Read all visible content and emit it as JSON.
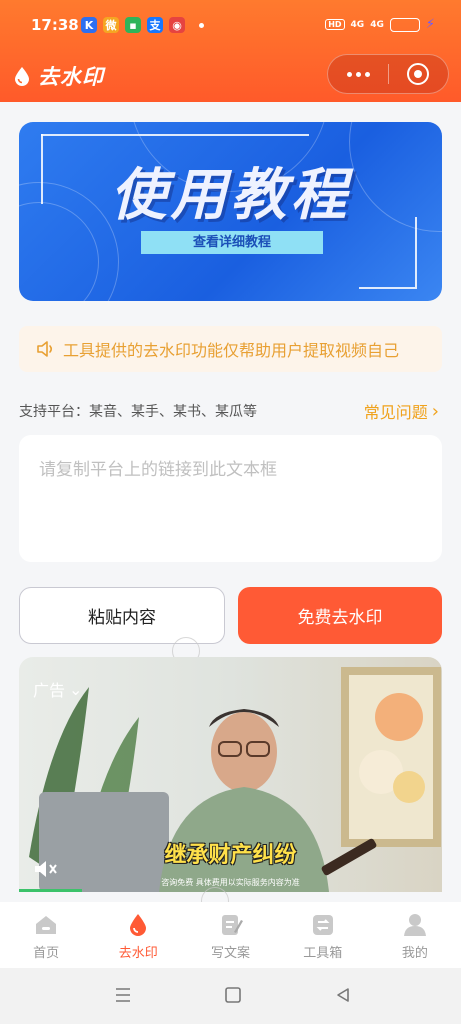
{
  "status_bar": {
    "time": "17:38",
    "app_icons": [
      {
        "name": "kuaishou-icon",
        "glyph": "K",
        "color": "#2e6ff0"
      },
      {
        "name": "weibo-icon",
        "glyph": "微",
        "color": "#f5a623"
      },
      {
        "name": "message-icon",
        "glyph": "▪",
        "color": "#2fb45a"
      },
      {
        "name": "alipay-icon",
        "glyph": "支",
        "color": "#1677ff"
      },
      {
        "name": "map-icon",
        "glyph": "◉",
        "color": "#e64340"
      }
    ],
    "hd_label": "HD",
    "signal1": "4G",
    "signal2": "4G"
  },
  "header": {
    "app_title": "去水印"
  },
  "banner": {
    "title": "使用教程",
    "button_label": "查看详细教程"
  },
  "notice": {
    "text": "工具提供的去水印功能仅帮助用户提取视频自己"
  },
  "platforms": {
    "label": "支持平台：某音、某手、某书、某瓜等",
    "faq_label": "常见问题"
  },
  "link_input": {
    "placeholder": "请复制平台上的链接到此文本框",
    "value": ""
  },
  "actions": {
    "paste_label": "粘贴内容",
    "remove_label": "免费去水印"
  },
  "ad": {
    "label": "广告",
    "caption": "继承财产纠纷",
    "subcaption": "咨询免费 具体费用以实际服务内容为准"
  },
  "tabbar": {
    "tabs": [
      {
        "label": "首页",
        "icon": "home-icon",
        "active": false
      },
      {
        "label": "去水印",
        "icon": "drop-icon",
        "active": true
      },
      {
        "label": "写文案",
        "icon": "edit-icon",
        "active": false
      },
      {
        "label": "工具箱",
        "icon": "toolbox-icon",
        "active": false
      },
      {
        "label": "我的",
        "icon": "user-icon",
        "active": false
      }
    ]
  },
  "colors": {
    "brand": "#ff5a35",
    "banner_blue": "#1a5fe0",
    "notice_text": "#e8a033",
    "faq": "#f0a21c"
  }
}
